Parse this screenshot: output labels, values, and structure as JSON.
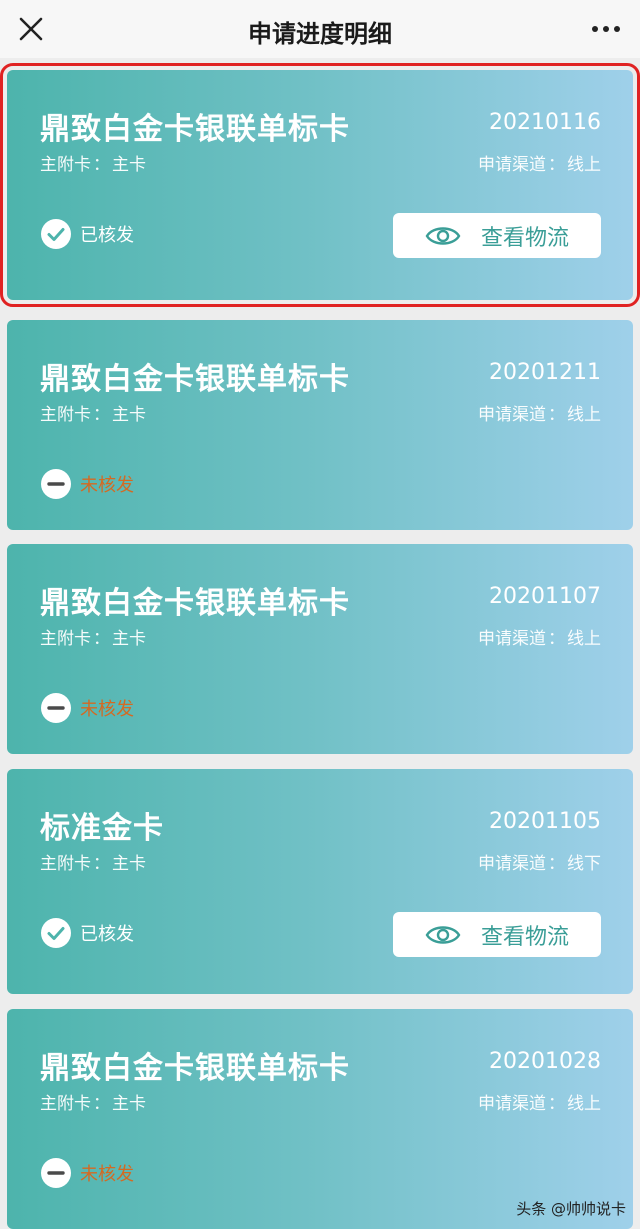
{
  "header": {
    "title": "申请进度明细"
  },
  "labels": {
    "card_type_key": "主附卡",
    "channel_key": "申请渠道",
    "separator": "：",
    "logistics_button": "查看物流"
  },
  "applications": [
    {
      "name": "鼎致白金卡银联单标卡",
      "date": "20210116",
      "card_type": "主卡",
      "channel": "线上",
      "status": "已核发",
      "status_kind": "issued",
      "has_logistics": true,
      "highlighted": true
    },
    {
      "name": "鼎致白金卡银联单标卡",
      "date": "20201211",
      "card_type": "主卡",
      "channel": "线上",
      "status": "未核发",
      "status_kind": "pending",
      "has_logistics": false,
      "highlighted": false
    },
    {
      "name": "鼎致白金卡银联单标卡",
      "date": "20201107",
      "card_type": "主卡",
      "channel": "线上",
      "status": "未核发",
      "status_kind": "pending",
      "has_logistics": false,
      "highlighted": false
    },
    {
      "name": "标准金卡",
      "date": "20201105",
      "card_type": "主卡",
      "channel": "线下",
      "status": "已核发",
      "status_kind": "issued",
      "has_logistics": true,
      "highlighted": false
    },
    {
      "name": "鼎致白金卡银联单标卡",
      "date": "20201028",
      "card_type": "主卡",
      "channel": "线上",
      "status": "未核发",
      "status_kind": "pending",
      "has_logistics": false,
      "highlighted": false
    }
  ],
  "watermark": "头条 @帅帅说卡",
  "colors": {
    "accent": "#3a9e97",
    "pending": "#d46a22",
    "highlight_border": "#e02222"
  }
}
